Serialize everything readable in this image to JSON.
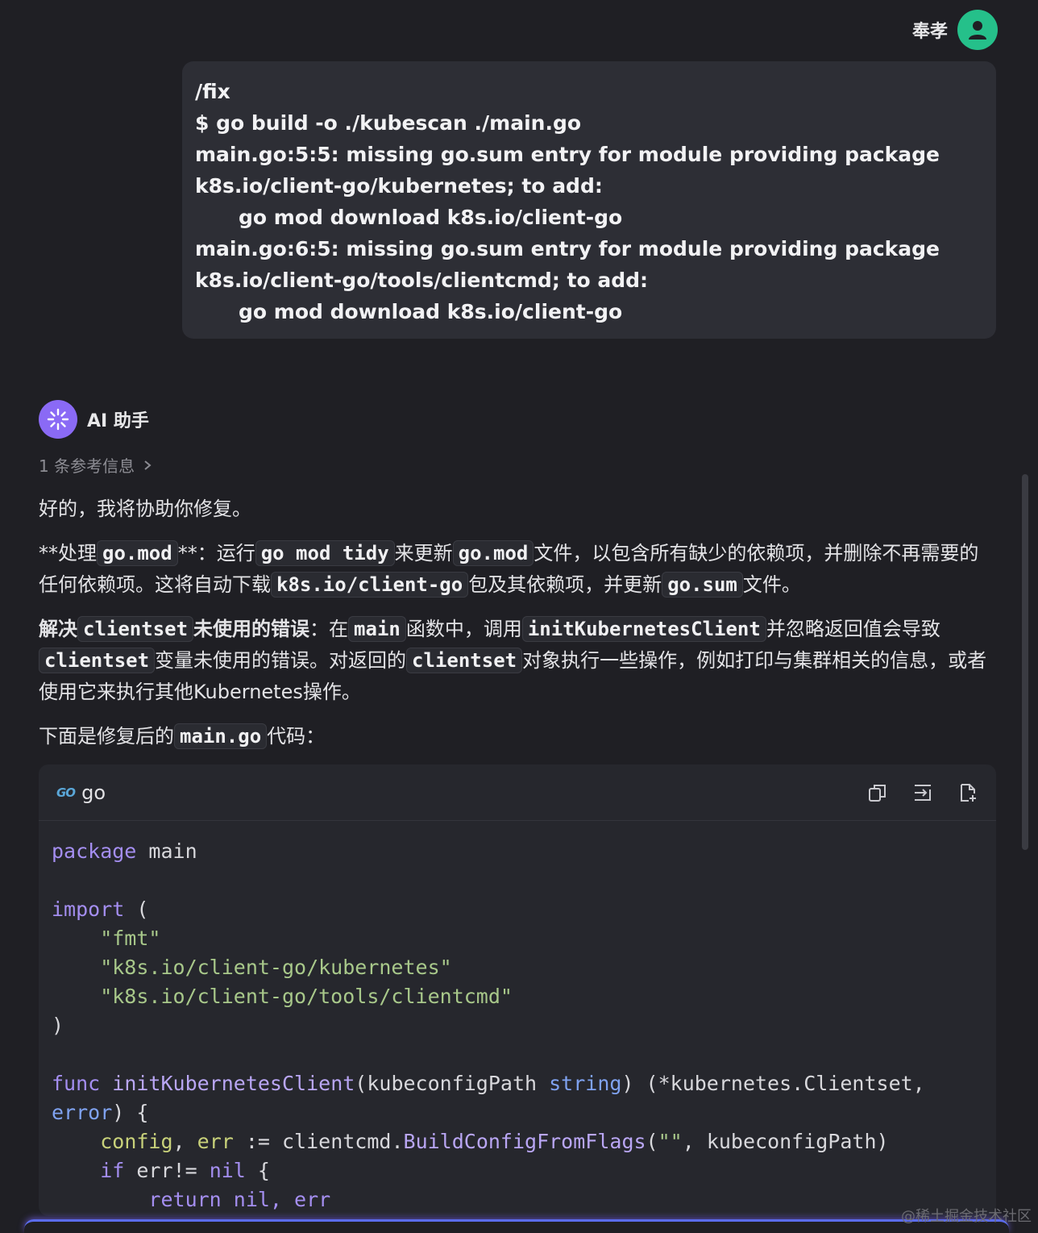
{
  "user": {
    "name": "奉孝",
    "message_lines": [
      "/fix",
      "$ go build -o ./kubescan ./main.go",
      "main.go:5:5: missing go.sum entry for module providing package",
      "k8s.io/client-go/kubernetes; to add:",
      "go mod download k8s.io/client-go",
      "main.go:6:5: missing go.sum entry for module providing package",
      "k8s.io/client-go/tools/clientcmd; to add:",
      "go mod download k8s.io/client-go"
    ]
  },
  "assistant": {
    "name": "AI 助手",
    "refs_label": "1 条参考信息",
    "intro": "好的，我将协助你修复。",
    "p1": {
      "a": "**处理",
      "code1": "go.mod",
      "b": "**：运行",
      "code2": "go mod tidy",
      "c": "来更新",
      "code3": "go.mod",
      "d": "文件，以包含所有缺少的依赖项，并删除不再需要的任何依赖项。这将自动下载",
      "code4": "k8s.io/client-go",
      "e": "包及其依赖项，并更新",
      "code5": "go.sum",
      "f": "文件。"
    },
    "p2": {
      "a": "解决",
      "code1": "clientset",
      "b": "未使用的错误",
      "c": "：在",
      "code2": "main",
      "d": "函数中，调用",
      "code3": "initKubernetesClient",
      "e": "并忽略返回值会导致",
      "code4": "clientset",
      "f": "变量未使用的错误。对返回的",
      "code5": "clientset",
      "g": "对象执行一些操作，例如打印与集群相关的信息，或者使用它来执行其他Kubernetes操作。"
    },
    "p3": {
      "a": "下面是修复后的",
      "code1": "main.go",
      "b": "代码："
    }
  },
  "code_block": {
    "lang_logo": "GO",
    "language": "go",
    "tools": [
      "copy-icon",
      "insert-icon",
      "new-file-icon"
    ],
    "tokens": {
      "package": "package",
      "main": " main",
      "import": "import",
      "paren_open": " (",
      "imp1": "    \"fmt\"",
      "imp2": "    \"k8s.io/client-go/kubernetes\"",
      "imp3": "    \"k8s.io/client-go/tools/clientcmd\"",
      "paren_close": ")",
      "func": "func",
      "fname": " initKubernetesClient",
      "params_a": "(kubeconfigPath ",
      "string": "string",
      "params_b": ") (*kubernetes.Clientset,",
      "error": "error",
      "brace": ") {",
      "indent": "    ",
      "config": "config",
      "comma": ", ",
      "err": "err",
      "assign": " := clientcmd.",
      "build": "BuildConfigFromFlags",
      "args_a": "(",
      "empty_str": "\"\"",
      "args_b": ", kubeconfigPath)",
      "if": "if",
      "cond": " err!= ",
      "nil": "nil",
      "open": " {",
      "ret_line": "        return nil, err"
    }
  },
  "watermark": "@稀土掘金技术社区",
  "colors": {
    "background": "#1f1f24",
    "user_avatar": "#25c08a",
    "ai_avatar": "#8a6af5",
    "keyword": "#a48ef0",
    "string": "#a8c88a"
  }
}
